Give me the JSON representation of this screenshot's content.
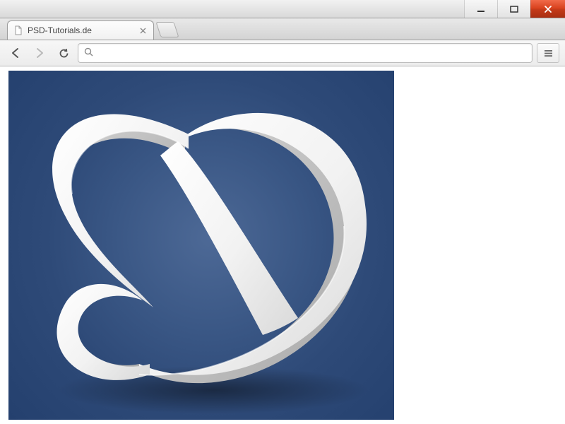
{
  "window": {
    "controls": {
      "minimize": "minimize",
      "maximize": "maximize",
      "close": "close"
    }
  },
  "tabs": [
    {
      "title": "PSD-Tutorials.de",
      "favicon": "document-icon",
      "active": true
    }
  ],
  "toolbar": {
    "back_enabled": true,
    "forward_enabled": false,
    "reload_label": "reload",
    "menu_label": "menu"
  },
  "omnibox": {
    "value": "",
    "placeholder": ""
  },
  "content": {
    "image_alt": "white twisted ribbon shape on dark blue background"
  }
}
